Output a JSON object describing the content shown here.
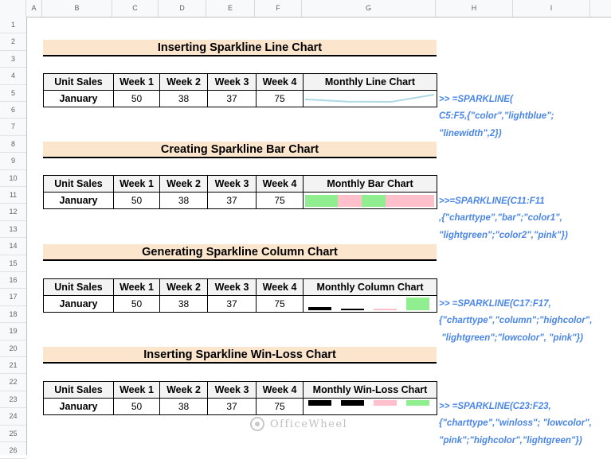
{
  "columns": [
    "A",
    "B",
    "C",
    "D",
    "E",
    "F",
    "G",
    "H",
    "I"
  ],
  "rows": [
    "1",
    "2",
    "3",
    "4",
    "5",
    "6",
    "7",
    "8",
    "9",
    "10",
    "11",
    "12",
    "13",
    "14",
    "15",
    "16",
    "17",
    "18",
    "19",
    "20",
    "21",
    "22",
    "23",
    "24",
    "25",
    "26"
  ],
  "headers": {
    "unit_sales": "Unit Sales",
    "w1": "Week 1",
    "w2": "Week 2",
    "w3": "Week 3",
    "w4": "Week 4"
  },
  "sections": [
    {
      "title": "Inserting Sparkline Line Chart",
      "chart_header": "Monthly Line Chart"
    },
    {
      "title": "Creating Sparkline Bar Chart",
      "chart_header": "Monthly Bar Chart"
    },
    {
      "title": "Generating Sparkline Column Chart",
      "chart_header": "Monthly Column Chart"
    },
    {
      "title": "Inserting Sparkline Win-Loss Chart",
      "chart_header": "Monthly Win-Loss Chart"
    }
  ],
  "row_label": "January",
  "values": [
    "50",
    "38",
    "37",
    "75"
  ],
  "formulas": [
    ">> =SPARKLINE(\nC5:F5,{\"color\",\"lightblue\";\n\"linewidth\",2})",
    ">>=SPARKLINE(C11:F11\n,{\"charttype\",\"bar\";\"color1\",\n\"lightgreen\";\"color2\",\"pink\"})",
    ">> =SPARKLINE(C17:F17,\n{\"charttype\",\"column\";\"highcolor\",\n \"lightgreen\";\"lowcolor\", \"pink\"})",
    ">> =SPARKLINE(C23:F23,\n{\"charttype\",\"winloss\"; \"lowcolor\",\n\"pink\";\"highcolor\",\"lightgreen\"})"
  ],
  "watermark": "OfficeWheel",
  "colors": {
    "title_bg": "#fce5cd",
    "formula": "#4a86e8",
    "lightblue": "#add8e6",
    "lightgreen": "#90ee90",
    "pink": "#ffc0cb"
  },
  "sparkline_values": [
    50,
    38,
    37,
    75
  ]
}
